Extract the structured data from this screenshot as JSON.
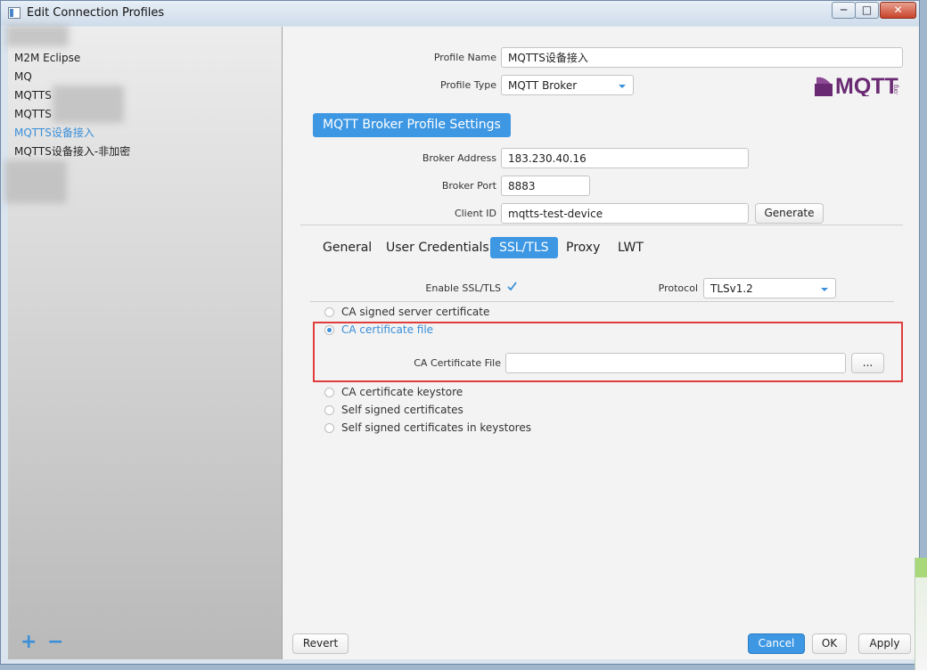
{
  "window": {
    "title": "Edit Connection Profiles",
    "minimize_label": "─",
    "maximize_label": "□",
    "close_label": "✕"
  },
  "sidebar": {
    "items": [
      {
        "label": "M2M Eclipse",
        "selected": false
      },
      {
        "label": "MQ",
        "selected": false
      },
      {
        "label": "MQTTS",
        "selected": false
      },
      {
        "label": "MQTTS",
        "selected": false
      },
      {
        "label": "MQTTS设备接入",
        "selected": true
      },
      {
        "label": "MQTTS设备接入-非加密",
        "selected": false
      }
    ],
    "add_label": "+",
    "remove_label": "−"
  },
  "profile": {
    "name_label": "Profile Name",
    "name_value": "MQTTS设备接入",
    "type_label": "Profile Type",
    "type_value": "MQTT Broker",
    "logo_text": "MQTT",
    "logo_subtext": ".org"
  },
  "broker_settings": {
    "header": "MQTT Broker Profile Settings",
    "address_label": "Broker Address",
    "address_value": "183.230.40.16",
    "port_label": "Broker Port",
    "port_value": "8883",
    "client_id_label": "Client ID",
    "client_id_value": "mqtts-test-device",
    "generate_label": "Generate"
  },
  "tabs": [
    {
      "label": "General",
      "active": false
    },
    {
      "label": "User Credentials",
      "active": false
    },
    {
      "label": "SSL/TLS",
      "active": true
    },
    {
      "label": "Proxy",
      "active": false
    },
    {
      "label": "LWT",
      "active": false
    }
  ],
  "ssl": {
    "enable_label": "Enable SSL/TLS",
    "enable_checked": true,
    "protocol_label": "Protocol",
    "protocol_value": "TLSv1.2",
    "options": [
      {
        "label": "CA signed server certificate",
        "checked": false
      },
      {
        "label": "CA certificate file",
        "checked": true
      },
      {
        "label": "CA certificate keystore",
        "checked": false
      },
      {
        "label": "Self signed certificates",
        "checked": false
      },
      {
        "label": "Self signed certificates in keystores",
        "checked": false
      }
    ],
    "ca_file_label": "CA Certificate File",
    "ca_file_value": "",
    "browse_label": "..."
  },
  "footer": {
    "revert_label": "Revert",
    "cancel_label": "Cancel",
    "ok_label": "OK",
    "apply_label": "Apply"
  },
  "colors": {
    "accent": "#3d97e3",
    "selected_text": "#3a8fd8",
    "highlight_border": "#e03c3c",
    "logo_purple": "#6a2a73"
  }
}
